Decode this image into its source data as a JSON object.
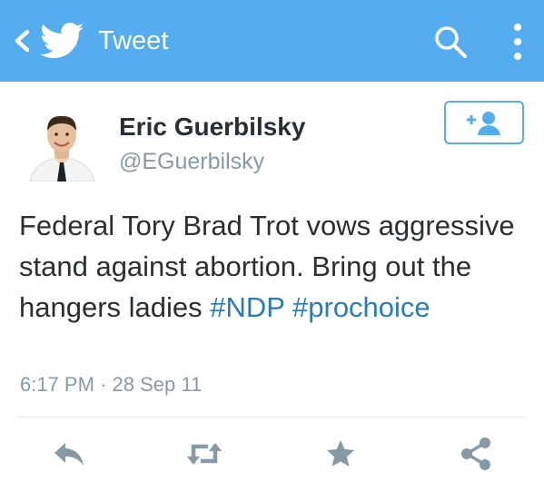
{
  "header": {
    "title": "Tweet",
    "bg_color": "#55acee",
    "icons": [
      "back-icon",
      "twitter-bird-icon",
      "search-icon",
      "more-vertical-icon"
    ]
  },
  "author": {
    "name": "Eric Guerbilsky",
    "handle": "@EGuerbilsky"
  },
  "follow_button": {
    "icon": "follow-user-icon"
  },
  "tweet": {
    "text_before": "Federal Tory Brad Trot vows aggressive stand against abortion. Bring out the hangers ladies ",
    "hashtag1": "#NDP",
    "separator": " ",
    "hashtag2": "#prochoice",
    "hashtag_color": "#2b7bb9"
  },
  "meta": {
    "time": "6:17 PM",
    "dot": "·",
    "date": "28 Sep 11"
  },
  "actions": [
    "reply-icon",
    "retweet-icon",
    "favorite-icon",
    "share-icon"
  ]
}
